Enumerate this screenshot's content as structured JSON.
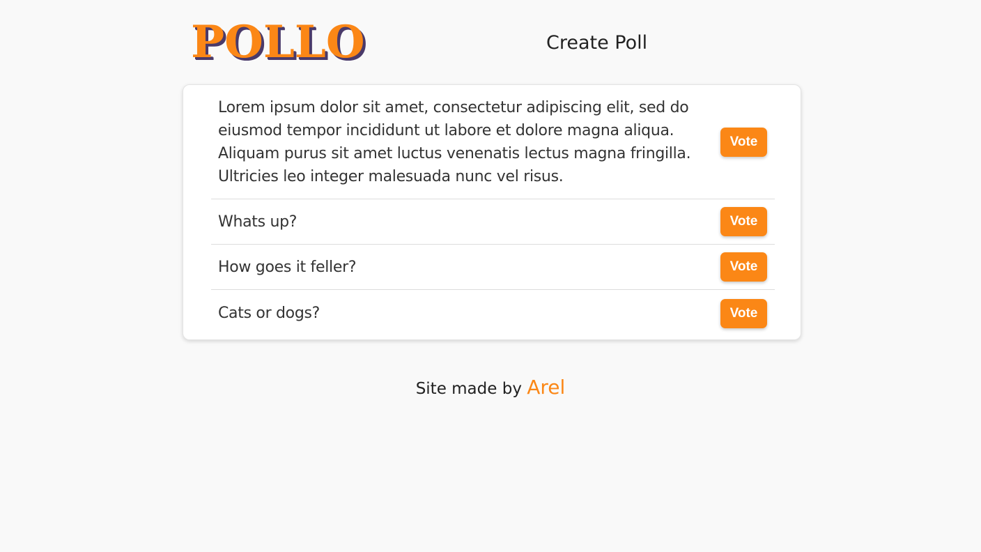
{
  "header": {
    "logo_text": "POLLO",
    "nav_create": "Create Poll"
  },
  "polls": [
    {
      "question": "Lorem ipsum dolor sit amet, consectetur adipiscing elit, sed do eiusmod tempor incididunt ut labore et dolore magna aliqua. Aliquam purus sit amet luctus venenatis lectus magna fringilla. Ultricies leo integer malesuada nunc vel risus.",
      "vote_label": "Vote"
    },
    {
      "question": "Whats up?",
      "vote_label": "Vote"
    },
    {
      "question": "How goes it feller?",
      "vote_label": "Vote"
    },
    {
      "question": "Cats or dogs?",
      "vote_label": "Vote"
    }
  ],
  "footer": {
    "prefix": "Site made by",
    "author": "Arel"
  },
  "colors": {
    "accent": "#fb8716",
    "logo_shadow": "#4a3a6a",
    "background": "#f9f9f9",
    "card": "#ffffff"
  }
}
